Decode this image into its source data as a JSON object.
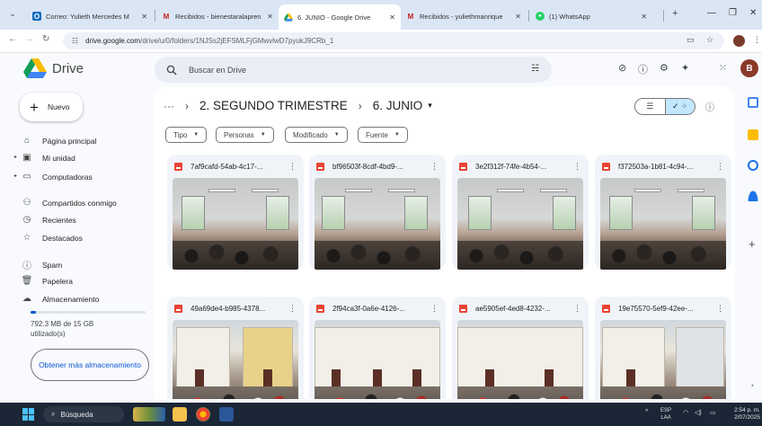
{
  "browser": {
    "tabs": [
      {
        "title": "Correo: Yulieth Mercedes M",
        "icon": "outlook-icon",
        "active": false
      },
      {
        "title": "Recibidos - bienestaralapren",
        "icon": "gmail-icon",
        "active": false
      },
      {
        "title": "6. JUNIO - Google Drive",
        "icon": "drive-icon",
        "active": true
      },
      {
        "title": "Recibidos - yuliethmanrique",
        "icon": "gmail-icon",
        "active": false
      },
      {
        "title": "(1) WhatsApp",
        "icon": "whatsapp-icon",
        "active": false
      }
    ],
    "url_domain": "drive.google.com",
    "url_path": "/drive/u/0/folders/1NJSs2jEFSMLFjGMwvlwD7pyukJ9CRb_1"
  },
  "drive": {
    "app_name": "Drive",
    "search_placeholder": "Buscar en Drive",
    "avatar_letter": "B",
    "accent_color": "#0b57d0"
  },
  "sidebar": {
    "new_label": "Nuevo",
    "items": [
      {
        "label": "Página principal",
        "icon": "home-icon"
      },
      {
        "label": "Mi unidad",
        "icon": "my-drive-icon"
      },
      {
        "label": "Computadoras",
        "icon": "computer-icon"
      },
      {
        "label": "Compartidos conmigo",
        "icon": "shared-icon"
      },
      {
        "label": "Recientes",
        "icon": "clock-icon"
      },
      {
        "label": "Destacados",
        "icon": "star-icon"
      },
      {
        "label": "Spam",
        "icon": "spam-icon"
      },
      {
        "label": "Papelera",
        "icon": "trash-icon"
      },
      {
        "label": "Almacenamiento",
        "icon": "cloud-icon"
      }
    ],
    "storage_used_fraction": 0.05,
    "storage_text": "792.3 MB de 15 GB utilizado(s)",
    "more_storage_label": "Obtener más almacenamiento"
  },
  "main": {
    "breadcrumb": [
      "2. SEGUNDO TRIMESTRE",
      "6. JUNIO"
    ],
    "filters": [
      "Tipo",
      "Personas",
      "Modificado",
      "Fuente"
    ],
    "files": [
      {
        "name": "7af9cafd-54ab-4c17-...",
        "thumb": "room"
      },
      {
        "name": "bf96503f-8cdf-4bd9-...",
        "thumb": "room"
      },
      {
        "name": "3e2f312f-74fe-4b54-...",
        "thumb": "room"
      },
      {
        "name": "f372503a-1b81-4c94-...",
        "thumb": "room"
      },
      {
        "name": "49a69de4-b985-4378...",
        "thumb": "street"
      },
      {
        "name": "2f94ca3f-0a6e-4126-...",
        "thumb": "street"
      },
      {
        "name": "ae5905ef-4ed8-4232-...",
        "thumb": "street"
      },
      {
        "name": "19e75570-5ef9-42ee-...",
        "thumb": "street"
      }
    ]
  },
  "taskbar": {
    "search_label": "Búsqueda",
    "lang_line1": "ESP",
    "lang_line2": "LAA",
    "time": "2:54 p. m.",
    "date": "2/07/2025"
  }
}
